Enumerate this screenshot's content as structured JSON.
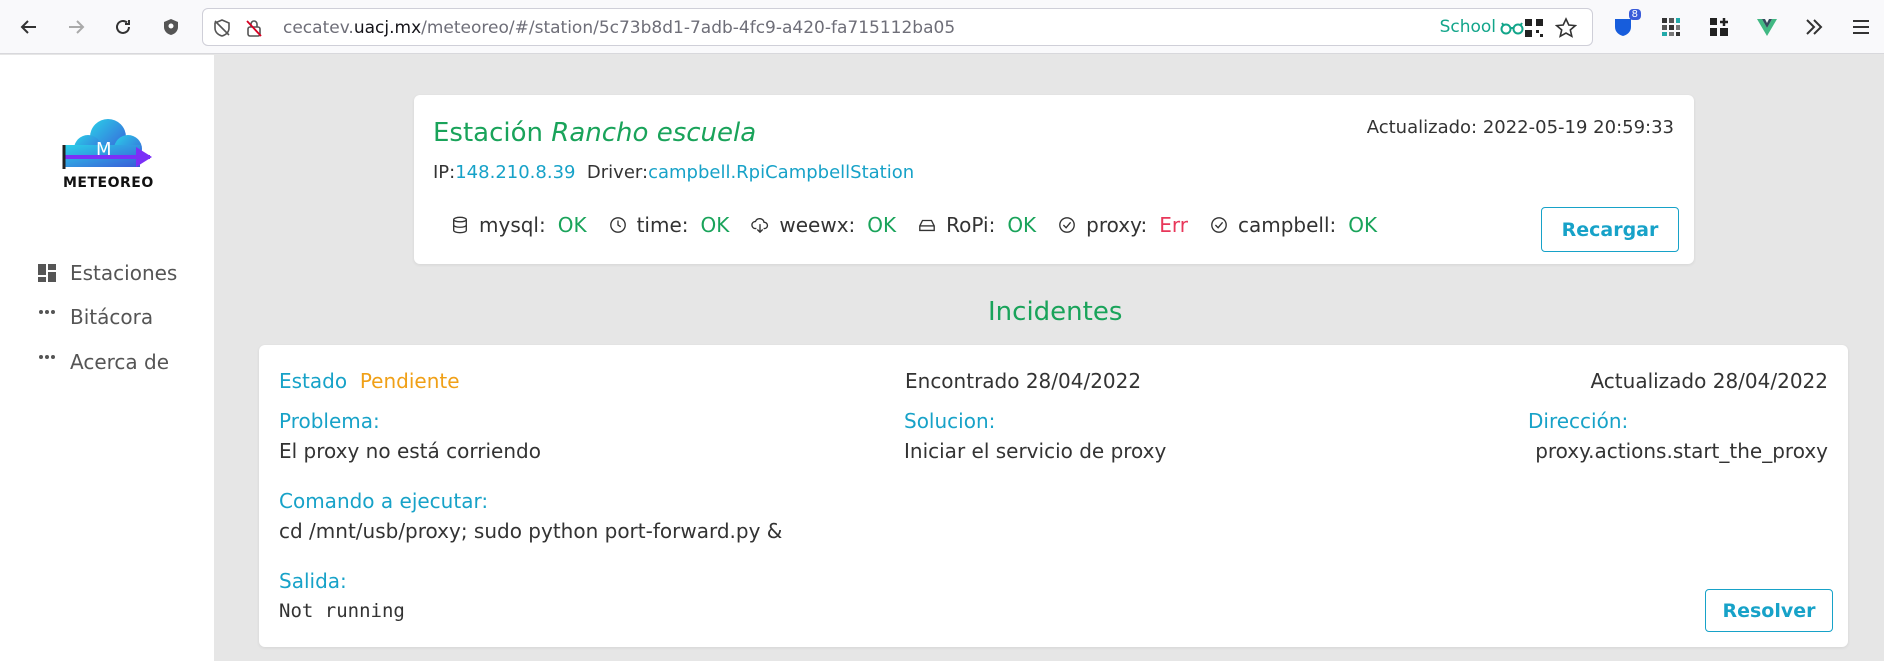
{
  "browser": {
    "url_prefix": "cecatev.",
    "url_domain": "uacj.mx",
    "url_path": "/meteoreo/#/station/5c73b8d1-7adb-4fc9-a420-fa715112ba05",
    "container_label": "School",
    "extension_badge": "8"
  },
  "sidebar": {
    "logo_text": "METEOREO",
    "items": [
      {
        "label": "Estaciones",
        "icon": "dashboard-icon"
      },
      {
        "label": "Bitácora",
        "icon": "dots-icon"
      },
      {
        "label": "Acerca de",
        "icon": "dots-icon"
      }
    ]
  },
  "station": {
    "title_prefix": "Estación",
    "title_name": "Rancho escuela",
    "updated": "Actualizado: 2022-05-19 20:59:33",
    "ip_label": "IP:",
    "ip": "148.210.8.39",
    "driver_label": "Driver:",
    "driver": "campbell.RpiCampbellStation",
    "statuses": [
      {
        "name": "mysql:",
        "value": "OK",
        "icon": "database-icon",
        "state": "ok"
      },
      {
        "name": "time:",
        "value": "OK",
        "icon": "clock-icon",
        "state": "ok"
      },
      {
        "name": "weewx:",
        "value": "OK",
        "icon": "cloud-download-icon",
        "state": "ok"
      },
      {
        "name": "RoPi:",
        "value": "OK",
        "icon": "hard-drive-icon",
        "state": "ok"
      },
      {
        "name": "proxy:",
        "value": "Err",
        "icon": "check-circle-icon",
        "state": "err"
      },
      {
        "name": "campbell:",
        "value": "OK",
        "icon": "check-circle-icon",
        "state": "ok"
      }
    ],
    "reload_label": "Recargar"
  },
  "incidents": {
    "title": "Incidentes",
    "items": [
      {
        "estado_label": "Estado",
        "estado_value": "Pendiente",
        "found": "Encontrado 28/04/2022",
        "updated": "Actualizado 28/04/2022",
        "problem_label": "Problema:",
        "problem": "El proxy no está corriendo",
        "solution_label": "Solucion:",
        "solution": "Iniciar el servicio de proxy",
        "direction_label": "Dirección:",
        "direction": "proxy.actions.start_the_proxy",
        "command_label": "Comando a ejecutar:",
        "command": "cd /mnt/usb/proxy; sudo python port-forward.py &",
        "output_label": "Salida:",
        "output": "Not running",
        "resolve_label": "Resolver"
      }
    ]
  },
  "colors": {
    "green": "#19a35a",
    "teal": "#17a2c8",
    "error": "#e8375a",
    "pending": "#f0a017"
  }
}
